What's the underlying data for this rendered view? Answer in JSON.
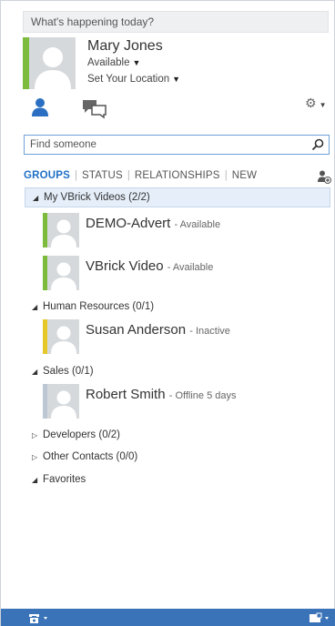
{
  "note": {
    "placeholder": "What's happening today?"
  },
  "profile": {
    "name": "Mary Jones",
    "status": "Available",
    "location": "Set Your Location",
    "status_color": "#7dbb3d"
  },
  "tabs": {
    "contacts_icon": "contacts-icon",
    "conversations_icon": "conversations-icon",
    "options_icon": "gear-icon"
  },
  "search": {
    "placeholder": "Find someone",
    "icon": "search-icon"
  },
  "view_tabs": [
    "GROUPS",
    "STATUS",
    "RELATIONSHIPS",
    "NEW"
  ],
  "groups": [
    {
      "label": "My VBrick Videos (2/2)",
      "expanded": true,
      "contacts": [
        {
          "name": "DEMO-Advert",
          "presence": "- Available",
          "status": "available"
        },
        {
          "name": "VBrick Video",
          "presence": "- Available",
          "status": "available"
        }
      ]
    },
    {
      "label": "Human Resources (0/1)",
      "expanded": true,
      "contacts": [
        {
          "name": "Susan Anderson",
          "presence": "- Inactive",
          "status": "inactive"
        }
      ]
    },
    {
      "label": "Sales (0/1)",
      "expanded": true,
      "contacts": [
        {
          "name": "Robert Smith",
          "presence": "- Offline 5 days",
          "status": "offline"
        }
      ]
    },
    {
      "label": "Developers (0/2)",
      "expanded": false,
      "contacts": []
    },
    {
      "label": "Other Contacts (0/0)",
      "expanded": false,
      "contacts": []
    },
    {
      "label": "Favorites",
      "expanded": true,
      "contacts": []
    }
  ],
  "colors": {
    "accent": "#1f6fc5",
    "bottom_bar": "#3a73b7",
    "available": "#7dbb3d",
    "inactive": "#e6c72a",
    "offline": "#bcc7d3"
  }
}
